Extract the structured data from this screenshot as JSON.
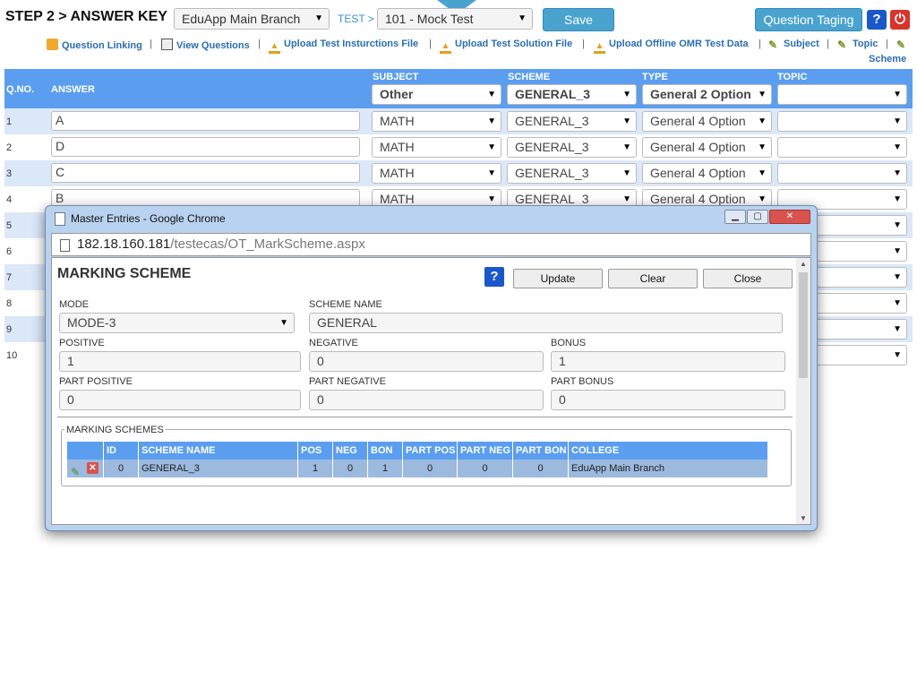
{
  "header": {
    "step_title": "STEP 2 > ANSWER KEY",
    "branch_select": "EduApp Main Branch",
    "test_label": "TEST >",
    "test_select": "101 - Mock Test",
    "save_label": "Save",
    "question_taging_label": "Question Taging",
    "help_label": "?",
    "power_label": "⏻"
  },
  "links": [
    {
      "label": "Question Linking",
      "icon": "link-icon"
    },
    {
      "label": "View Questions",
      "icon": "list-icon"
    },
    {
      "label": "Upload Test Insturctions File",
      "icon": "upload-icon"
    },
    {
      "label": "Upload Test Solution File",
      "icon": "upload-icon"
    },
    {
      "label": "Upload Offline OMR Test Data",
      "icon": "upload-icon"
    },
    {
      "label": "Subject",
      "icon": "pencil-icon"
    },
    {
      "label": "Topic",
      "icon": "pencil-icon"
    },
    {
      "label": "Scheme",
      "icon": "pencil-icon"
    }
  ],
  "grid": {
    "columns": {
      "qno": "Q.NO.",
      "answer": "ANSWER",
      "subject": "SUBJECT",
      "scheme": "SCHEME",
      "type": "TYPE",
      "topic": "TOPIC"
    },
    "header_row": {
      "subject": "Other",
      "scheme": "GENERAL_3",
      "type": "General 2 Option",
      "topic": ""
    },
    "rows": [
      {
        "qno": "1",
        "answer": "A",
        "subject": "MATH",
        "scheme": "GENERAL_3",
        "type": "General 4 Option",
        "topic": ""
      },
      {
        "qno": "2",
        "answer": "D",
        "subject": "MATH",
        "scheme": "GENERAL_3",
        "type": "General 4 Option",
        "topic": ""
      },
      {
        "qno": "3",
        "answer": "C",
        "subject": "MATH",
        "scheme": "GENERAL_3",
        "type": "General 4 Option",
        "topic": ""
      },
      {
        "qno": "4",
        "answer": "B",
        "subject": "MATH",
        "scheme": "GENERAL_3",
        "type": "General 4 Option",
        "topic": ""
      },
      {
        "qno": "5"
      },
      {
        "qno": "6"
      },
      {
        "qno": "7"
      },
      {
        "qno": "8"
      },
      {
        "qno": "9"
      },
      {
        "qno": "10"
      }
    ]
  },
  "popup": {
    "window_title": "Master Entries - Google Chrome",
    "url_host": "182.18.160.181",
    "url_path": "/testecas/OT_MarkScheme.aspx",
    "title": "MARKING SCHEME",
    "help_label": "?",
    "update_label": "Update",
    "clear_label": "Clear",
    "close_label": "Close",
    "fields": {
      "mode_label": "MODE",
      "mode_value": "MODE-3",
      "scheme_name_label": "SCHEME NAME",
      "scheme_name_value": "GENERAL",
      "positive_label": "POSITIVE",
      "positive_value": "1",
      "negative_label": "NEGATIVE",
      "negative_value": "0",
      "bonus_label": "BONUS",
      "bonus_value": "1",
      "part_positive_label": "PART POSITIVE",
      "part_positive_value": "0",
      "part_negative_label": "PART NEGATIVE",
      "part_negative_value": "0",
      "part_bonus_label": "PART BONUS",
      "part_bonus_value": "0"
    },
    "schemes_legend": "MARKING SCHEMES",
    "table": {
      "headers": [
        "ID",
        "SCHEME NAME",
        "POS",
        "NEG",
        "BON",
        "PART POS",
        "PART NEG",
        "PART BON",
        "COLLEGE"
      ],
      "row": [
        "0",
        "GENERAL_3",
        "1",
        "0",
        "1",
        "0",
        "0",
        "0",
        "EduApp Main Branch"
      ]
    }
  },
  "colors": {
    "accent": "#4aa3cf",
    "grid_header": "#5b9ef0",
    "alt_row": "#dbe8f8"
  }
}
